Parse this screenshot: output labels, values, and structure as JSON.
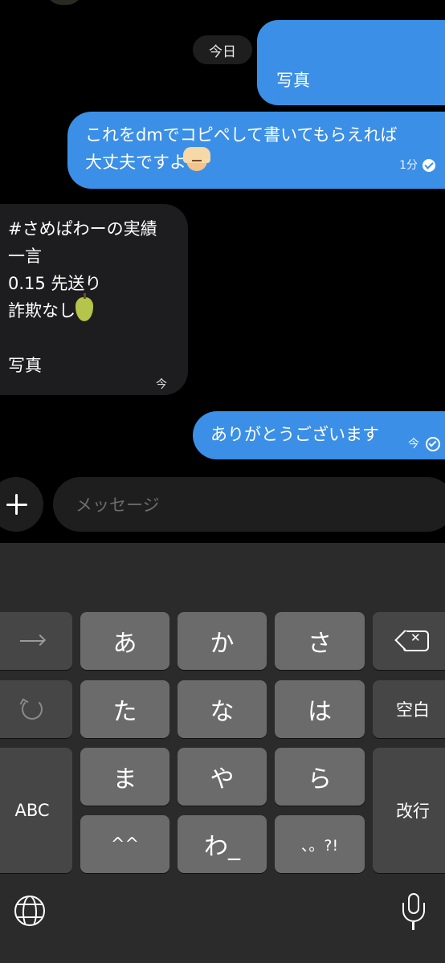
{
  "chat": {
    "date_label": "今日",
    "messages": {
      "photo_out": "写真",
      "dm_request": {
        "text": "これをdmでコピペして書いてもらえれば\n大丈夫ですよ",
        "emoji": "person-gesturing-ok",
        "time": "1分"
      },
      "incoming": {
        "lines": [
          "#さめぱわーの実績",
          "一言",
          "0.15 先送り",
          "詐欺なし"
        ],
        "emoji": "pear",
        "photo": "写真",
        "status": "今"
      },
      "thanks": {
        "text": "ありがとうございます",
        "status": "今"
      }
    }
  },
  "composer": {
    "placeholder": "メッセージ"
  },
  "keyboard": {
    "row1": [
      "あ",
      "か",
      "さ"
    ],
    "row2": [
      "た",
      "な",
      "は"
    ],
    "row3": [
      "ま",
      "や",
      "ら"
    ],
    "row4": [
      "^^",
      "わ_",
      "、。?!"
    ],
    "space_label": "空白",
    "abc_label": "ABC",
    "return_label": "改行",
    "icons": [
      "arrow-right-icon",
      "backspace-icon",
      "undo-icon",
      "globe-icon",
      "microphone-icon"
    ]
  },
  "colors": {
    "outgoing_bubble": "#3b8fe6",
    "incoming_bubble": "#1d1d1f",
    "keyboard_bg": "#2b2b2b",
    "key": "#6b6b6b",
    "key_dark": "#464646"
  }
}
